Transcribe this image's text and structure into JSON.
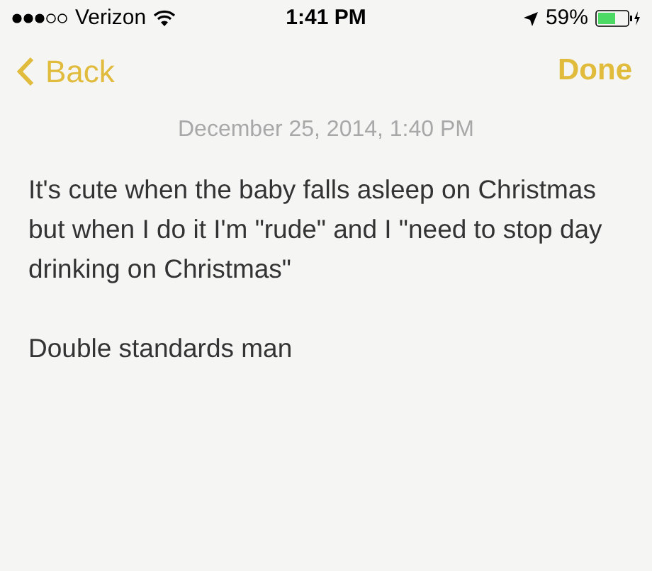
{
  "status_bar": {
    "carrier": "Verizon",
    "time": "1:41 PM",
    "battery": "59%"
  },
  "nav": {
    "back": "Back",
    "done": "Done"
  },
  "note": {
    "date": "December 25, 2014, 1:40 PM",
    "paragraphs": [
      "It's cute when the baby falls asleep on Christmas but when I do it I'm \"rude\" and I \"need to stop day drinking on Christmas\"",
      "Double standards man"
    ]
  }
}
